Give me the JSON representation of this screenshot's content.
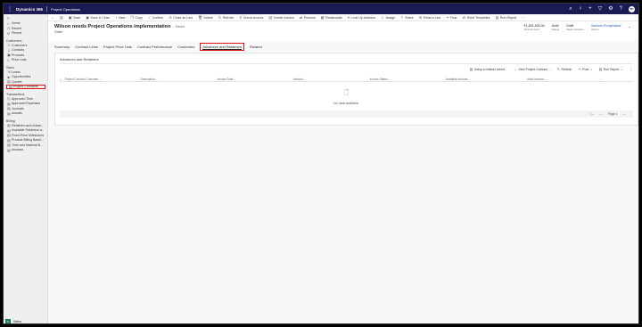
{
  "topbar": {
    "brand": "Dynamics 365",
    "app": "Project Operations",
    "icons": [
      "search-icon",
      "lightbulb-icon",
      "plus-icon",
      "filter-icon",
      "settings-icon",
      "help-icon"
    ],
    "user_initials": "SR"
  },
  "sidebar": {
    "top_items": [
      {
        "icon": "home-icon",
        "glyph": "⌂",
        "label": "Home"
      },
      {
        "icon": "clock-icon",
        "glyph": "◷",
        "label": "Recent"
      },
      {
        "icon": "pin-icon",
        "glyph": "⚲",
        "label": "Pinned"
      }
    ],
    "groups": [
      {
        "title": "Customers",
        "items": [
          {
            "icon": "person-icon",
            "glyph": "☺",
            "label": "Customers"
          },
          {
            "icon": "contact-icon",
            "glyph": "☺",
            "label": "Contacts"
          },
          {
            "icon": "box-icon",
            "glyph": "▣",
            "label": "Products"
          },
          {
            "icon": "list-icon",
            "glyph": "≡",
            "label": "Price Lists"
          }
        ]
      },
      {
        "title": "Sales",
        "items": [
          {
            "icon": "phone-icon",
            "glyph": "☏",
            "label": "Leads"
          },
          {
            "icon": "opportunity-icon",
            "glyph": "◈",
            "label": "Opportunities"
          },
          {
            "icon": "quote-icon",
            "glyph": "▤",
            "label": "Quotes"
          },
          {
            "icon": "contract-icon",
            "glyph": "▤",
            "label": "Project Contracts"
          }
        ]
      },
      {
        "title": "Transactions",
        "items": [
          {
            "icon": "time-icon",
            "glyph": "◷",
            "label": "Approved Time"
          },
          {
            "icon": "expense-icon",
            "glyph": "▤",
            "label": "Approved Expenses"
          },
          {
            "icon": "journal-icon",
            "glyph": "▤",
            "label": "Journals"
          },
          {
            "icon": "actuals-icon",
            "glyph": "▤",
            "label": "Actuals"
          }
        ]
      },
      {
        "title": "Billing",
        "items": [
          {
            "icon": "retainer-icon",
            "glyph": "▤",
            "label": "Retainers and Advan..."
          },
          {
            "icon": "retainer-icon",
            "glyph": "▤",
            "label": "Available Retainers a..."
          },
          {
            "icon": "milestone-icon",
            "glyph": "▤",
            "label": "Fixed Price Milestones"
          },
          {
            "icon": "backlog-icon",
            "glyph": "▤",
            "label": "Product Billing Backl..."
          },
          {
            "icon": "backlog-icon",
            "glyph": "▤",
            "label": "Time and Material B..."
          },
          {
            "icon": "invoice-icon",
            "glyph": "▤",
            "label": "Invoices"
          }
        ]
      }
    ],
    "area": {
      "badge": "S",
      "label": "Sales"
    }
  },
  "commandbar": [
    {
      "icon": "back-icon",
      "glyph": "←",
      "label": ""
    },
    {
      "icon": "form-icon",
      "glyph": "▤",
      "label": ""
    },
    {
      "icon": "save-icon",
      "glyph": "▣",
      "label": "Save"
    },
    {
      "icon": "save-close-icon",
      "glyph": "▣",
      "label": "Save & Close"
    },
    {
      "icon": "new-icon",
      "glyph": "+",
      "label": "New"
    },
    {
      "icon": "copy-icon",
      "glyph": "❐",
      "label": "Copy"
    },
    {
      "icon": "confirm-icon",
      "glyph": "✓",
      "label": "Confirm"
    },
    {
      "icon": "lost-icon",
      "glyph": "⊘",
      "label": "Close as Lost"
    },
    {
      "icon": "delete-icon",
      "glyph": "🗑",
      "label": "Delete"
    },
    {
      "icon": "refresh-icon",
      "glyph": "↻",
      "label": "Refresh"
    },
    {
      "icon": "check-icon",
      "glyph": "⚲",
      "label": "Check Access"
    },
    {
      "icon": "invoice-icon",
      "glyph": "▤",
      "label": "Create Invoice"
    },
    {
      "icon": "process-icon",
      "glyph": "⇄",
      "label": "Process"
    },
    {
      "icon": "recalc-icon",
      "glyph": "▦",
      "label": "Recalculate"
    },
    {
      "icon": "address-icon",
      "glyph": "⌖",
      "label": "Look Up Address"
    },
    {
      "icon": "assign-icon",
      "glyph": "☺",
      "label": "Assign"
    },
    {
      "icon": "share-icon",
      "glyph": "⇪",
      "label": "Share"
    },
    {
      "icon": "email-icon",
      "glyph": "✉",
      "label": "Email a Link"
    },
    {
      "icon": "flow-icon",
      "glyph": "⤳",
      "label": "Flow"
    },
    {
      "icon": "word-icon",
      "glyph": "W",
      "label": "Word Templates"
    },
    {
      "icon": "report-icon",
      "glyph": "▤",
      "label": "Run Report"
    }
  ],
  "header": {
    "title": "Wilson needs Project Operations implementation",
    "saved": "- Saved",
    "entity": "Order",
    "fields": [
      {
        "value": "₹1,651,500.00",
        "label": "Total Amount",
        "link": false
      },
      {
        "value": "Draft",
        "label": "Status",
        "link": false
      },
      {
        "value": "Draft",
        "label": "Status Reason",
        "link": false
      },
      {
        "value": "Santosh Rongthatkar",
        "label": "Owner",
        "link": true
      }
    ]
  },
  "tabs": [
    {
      "label": "Summary",
      "active": false
    },
    {
      "label": "Contract Lines",
      "active": false
    },
    {
      "label": "Project Price Lists",
      "active": false
    },
    {
      "label": "Contract Performance",
      "active": false
    },
    {
      "label": "Customers",
      "active": false
    },
    {
      "label": "Advances and Retainers",
      "active": true
    },
    {
      "label": "Related",
      "active": false
    }
  ],
  "section": {
    "title": "Advances and Retainers",
    "subcommands": [
      {
        "icon": "add-icon",
        "glyph": "▤",
        "label": "Setup a retainer sched..."
      },
      {
        "icon": "view-icon",
        "glyph": "→",
        "label": "View Project Contract ..."
      },
      {
        "icon": "refresh-icon",
        "glyph": "↻",
        "label": "Refresh"
      },
      {
        "icon": "flow-icon",
        "glyph": "⤳",
        "label": "Flow"
      },
      {
        "icon": "report-icon",
        "glyph": "▤",
        "label": "Run Report"
      }
    ],
    "columns": [
      "Project Contract Customer",
      "Description",
      "Invoice Date",
      "Amount",
      "Invoice Status",
      "Available Amount",
      "Used Amount"
    ],
    "empty_text": "No data available.",
    "page_label": "Page 1"
  }
}
